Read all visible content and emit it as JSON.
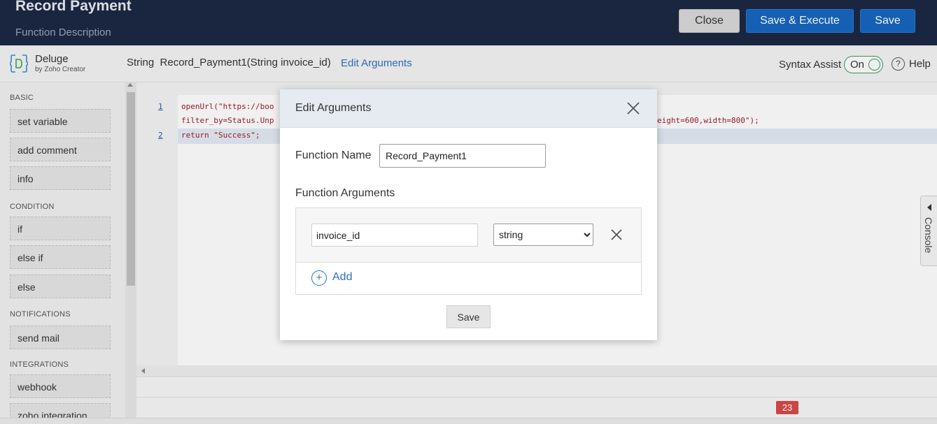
{
  "header": {
    "title": "Record Payment",
    "subtitle": "Function Description",
    "close_label": "Close",
    "save_execute_label": "Save & Execute",
    "save_label": "Save"
  },
  "toolbar": {
    "brand_name": "Deluge",
    "brand_by": "by Zoho Creator",
    "function_signature": "String  Record_Payment1(String invoice_id)",
    "edit_arguments_link": "Edit Arguments",
    "syntax_assist_label": "Syntax Assist",
    "syntax_assist_state": "On",
    "help_label": "Help"
  },
  "sidebar": {
    "sections": [
      {
        "title": "BASIC",
        "items": [
          "set variable",
          "add comment",
          "info"
        ]
      },
      {
        "title": "CONDITION",
        "items": [
          "if",
          "else if",
          "else"
        ]
      },
      {
        "title": "NOTIFICATIONS",
        "items": [
          "send mail"
        ]
      },
      {
        "title": "INTEGRATIONS",
        "items": [
          "webhook",
          "zoho integration"
        ]
      }
    ]
  },
  "editor": {
    "lines": [
      {
        "number": "1",
        "text": "openUrl(\"https://boo",
        "continuation": "filter_by=Status.Unp",
        "right_fragment": "eight=600,width=800\");"
      },
      {
        "number": "2",
        "text": "return \"Success\";"
      }
    ],
    "console_label": "Console",
    "error_badge": "23"
  },
  "modal": {
    "title": "Edit Arguments",
    "function_name_label": "Function Name",
    "function_name_value": "Record_Payment1",
    "function_arguments_label": "Function Arguments",
    "arguments": [
      {
        "name": "invoice_id",
        "type": "string"
      }
    ],
    "add_label": "Add",
    "save_label": "Save"
  },
  "colors": {
    "header_bg": "#1c2944",
    "primary_button": "#1767c0",
    "link": "#2f6fbf",
    "toggle_on": "#3d9c5d",
    "badge": "#d84a4a"
  }
}
